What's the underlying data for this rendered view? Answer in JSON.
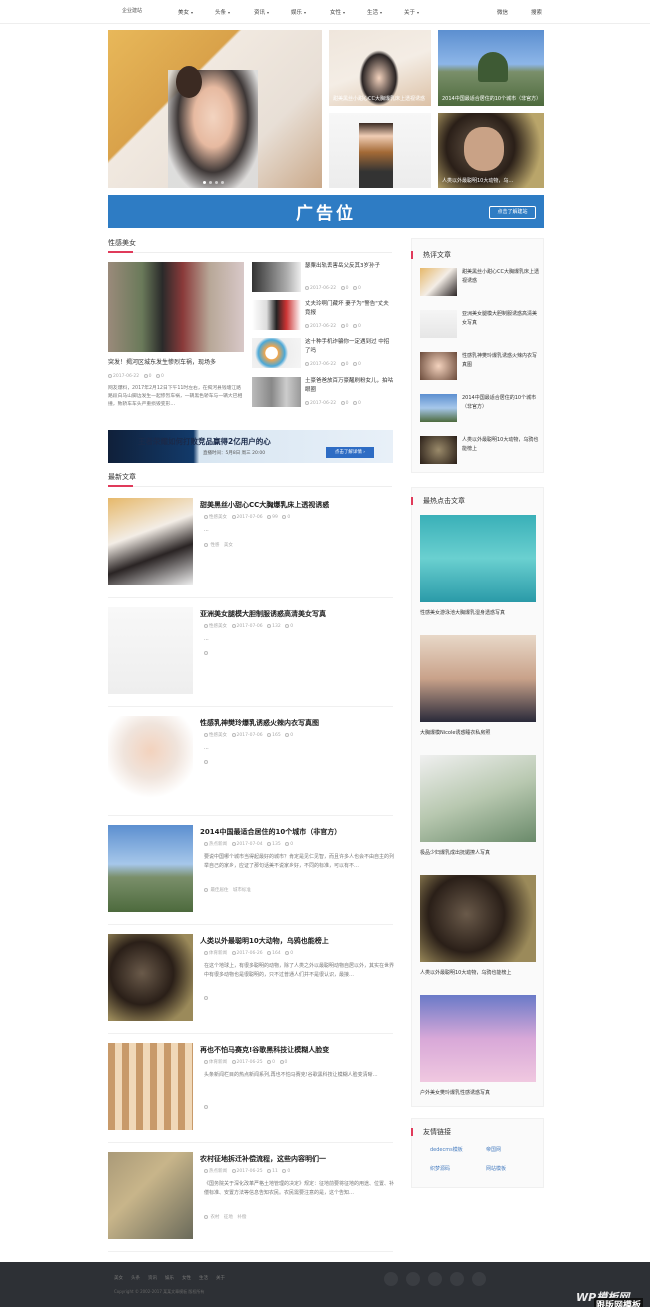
{
  "header": {
    "logo": "企业建站",
    "nav": [
      "美女",
      "头条",
      "资讯",
      "娱乐",
      "女性",
      "生活",
      "关于"
    ],
    "right": [
      "微信",
      "搜索"
    ]
  },
  "slider": {
    "captions": [
      "甜美黑丝小甜心CC大胸爆乳床上透视诱惑",
      "",
      "2014中国最适合居住的10个城市（非官方）",
      "",
      "人类以外最聪明10大动物，乌…"
    ]
  },
  "ad": {
    "text": "广告位",
    "button": "点击了解建站"
  },
  "sexy": {
    "heading": "性感美女",
    "feature": {
      "title": "突发！揭河区城东发生惨烈车祸，现场多",
      "date": "2017-06-22",
      "views": "0",
      "comments": "0",
      "desc": "网友爆料，2017年2月12日下午11时左右，在揭河县钱塘江路路段白马山脚边发生一起惨烈车祸，一辆黑色轿车与一辆大巴相撞，致轿车车头严重损毁变形…"
    },
    "items": [
      {
        "title": "瑟粟出轨丢害岳父反其3岁孙子",
        "date": "2017-06-22",
        "views": "0",
        "comments": "0"
      },
      {
        "title": "丈夫玲啊门藏坏 妻子为\"警告\"丈夫竟报",
        "date": "2017-06-22",
        "views": "0",
        "comments": "0"
      },
      {
        "title": "这十种手机诈骗你一定遇到过 中招了吗",
        "date": "2017-06-22",
        "views": "0",
        "comments": "0"
      },
      {
        "title": "土豪爸爸放百万豪醒刷粉女儿，拍咕眼圈",
        "date": "2017-06-22",
        "views": "0",
        "comments": "0"
      }
    ]
  },
  "banner2": {
    "text": "王者荣耀如何打败竞品赢得2亿用户的心",
    "sub": "直播时间：5月8日 周三 20:00",
    "btn": "点击了解详情 ›"
  },
  "latest": {
    "heading": "最新文章",
    "articles": [
      {
        "title": "甜美黑丝小甜心CC大胸爆乳床上透视诱惑",
        "cat": "性感美女",
        "date": "2017-07-06",
        "views": "99",
        "comments": "0",
        "desc": "...",
        "tags": "性感　美女"
      },
      {
        "title": "亚洲美女腿模大胆制服诱惑高清美女写真",
        "cat": "性感美女",
        "date": "2017-07-06",
        "views": "132",
        "comments": "0",
        "desc": "...",
        "tags": ""
      },
      {
        "title": "性感乳神樊玲爆乳诱惑火辣内衣写真图",
        "cat": "性感美女",
        "date": "2017-07-06",
        "views": "165",
        "comments": "0",
        "desc": "...",
        "tags": ""
      },
      {
        "title": "2014中国最适合居住的10个城市（非官方）",
        "cat": "热点新闻",
        "date": "2017-07-04",
        "views": "135",
        "comments": "0",
        "desc": "要说中国哪个城市当得起最好的城市？肯定是见仁见智，而且许多人也会不由自主的列举自己的家乡，应证了那句话美不说家乡好，不同的标准，可以有不…",
        "tags": "最佳居住　城市标准"
      },
      {
        "title": "人类以外最聪明10大动物，乌鸦也能榜上",
        "cat": "体育新闻",
        "date": "2017-06-26",
        "views": "164",
        "comments": "0",
        "desc": "在这个地球上，有很多聪明的动物，除了人类之外以最聪明动物自居以外，其实在世界中有很多动物也是很聪明的，只不过普通人们并不是很认识，最接…",
        "tags": ""
      },
      {
        "title": "再也不怕马赛克!谷歌黑科技让模糊人脸变",
        "cat": "体育新闻",
        "date": "2017-06-25",
        "views": "0",
        "comments": "0",
        "desc": "头条新闻栏目的热点新闻系列,再也不怕马赛克!谷歌黑科技让模糊人脸变清晰…",
        "tags": ""
      },
      {
        "title": "农村征地拆迁补偿流程，这些内容明们一",
        "cat": "热点新闻",
        "date": "2017-06-25",
        "views": "11",
        "comments": "0",
        "desc": "《国务院关于深化改革严格土地管理的决定》规定：征地前要将征地的用途、位置、补偿标准、安置方法等信息告知农民。农民需要注意的是，这个告知…",
        "tags": "农村　征地　补偿"
      }
    ]
  },
  "hot": {
    "heading": "热评文章",
    "items": [
      "甜美黑丝小甜心CC大胸爆乳床上透视诱惑",
      "亚洲美女腿模大胆制服诱惑高清美女写真",
      "性感乳神樊玲爆乳诱惑火辣内衣写真图",
      "2014中国最适合居住的10个城市（非官方）",
      "人类以外最聪明10大动物，乌鸦也能榜上"
    ]
  },
  "popular": {
    "heading": "最热点击文章",
    "items": [
      "性感美女游泳池大胸爆乳湿身透惑写真",
      "大胸爆模Nicole诱惑睡衣私房照",
      "极品少妇爆乳成出抚媚撩人写真",
      "人类以外最聪明10大动物，乌鸦也能榜上",
      "户外美女樊玲爆乳性感诱惑写真"
    ]
  },
  "links": {
    "heading": "友情链接",
    "items": [
      "dedecms模板",
      "帝国网",
      "织梦源码",
      "网站模板"
    ]
  },
  "footer": {
    "nav": [
      "美女",
      "头条",
      "资讯",
      "娱乐",
      "女性",
      "生活",
      "关于"
    ],
    "copy": "Copyright © 2002-2017 某某文章模板 版权所有",
    "wm1": "WP模板网",
    "wm2": "跟版网模板"
  },
  "colors": {
    "accent": "#e03a5a",
    "adblue": "#2e7cc4",
    "footer": "#2d3035"
  }
}
